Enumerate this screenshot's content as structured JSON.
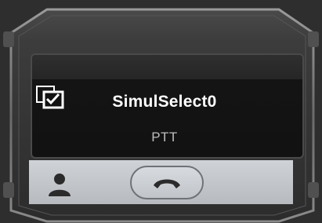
{
  "channel": {
    "name": "SimulSelect0",
    "mode": "PTT"
  },
  "icons": {
    "select": "multi-select-checkbox-icon",
    "contact": "user-icon",
    "end_call": "end-call-icon"
  },
  "colors": {
    "frame": "#3a3a3a",
    "display_background": "#121212",
    "bottom_bar": "#c4c7cb",
    "text_primary": "#ffffff",
    "text_secondary": "#bdbdbd"
  }
}
